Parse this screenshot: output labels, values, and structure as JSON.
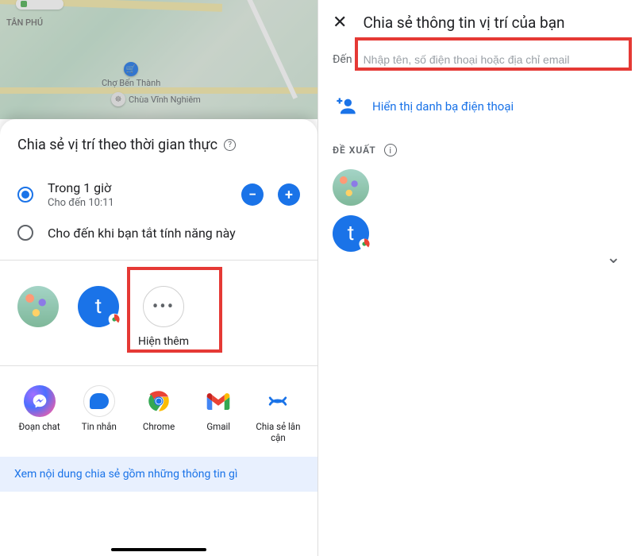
{
  "left": {
    "map": {
      "district_label": "TÂN PHÚ",
      "poi_market": "Chợ Bến Thành",
      "poi_pagoda": "Chùa Vĩnh Nghiêm"
    },
    "sheet": {
      "title": "Chia sẻ vị trí theo thời gian thực",
      "options": {
        "one_hour": {
          "label": "Trong 1 giờ",
          "until": "Cho đến 10:11"
        },
        "until_off": {
          "label": "Cho đến khi bạn tắt tính năng này"
        }
      },
      "more_label": "Hiện thêm",
      "apps": {
        "messenger": "Đoạn chat",
        "messages": "Tin nhắn",
        "chrome": "Chrome",
        "gmail": "Gmail",
        "nearby": "Chia sẻ lân cận"
      },
      "info_link": "Xem nội dung chia sẻ gồm những thông tin gì",
      "avatar_initial": "t"
    }
  },
  "right": {
    "title": "Chia sẻ thông tin vị trí của bạn",
    "dest_label": "Đến",
    "input_placeholder": "Nhập tên, số điện thoại hoặc địa chỉ email",
    "contacts_link": "Hiển thị danh bạ điện thoại",
    "section_label": "ĐỀ XUẤT",
    "avatar_initial": "t"
  }
}
